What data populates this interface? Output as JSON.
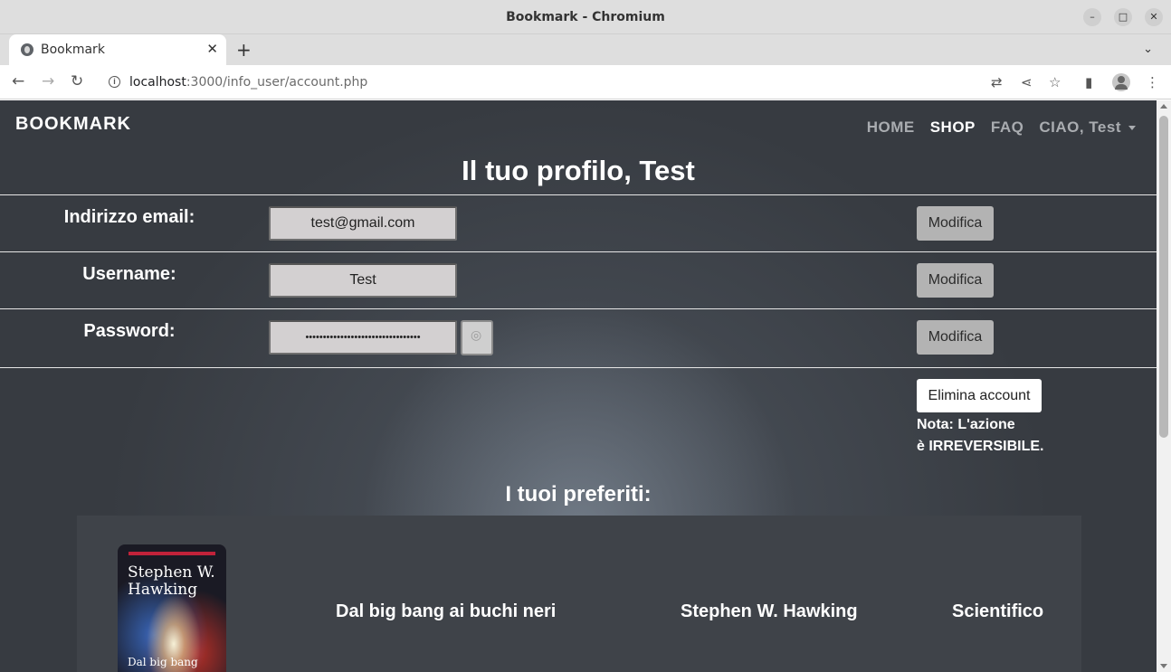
{
  "window": {
    "title": "Bookmark - Chromium"
  },
  "tabs": [
    {
      "label": "Bookmark"
    }
  ],
  "toolbar": {
    "url_host": "localhost",
    "url_rest": ":3000/info_user/account.php"
  },
  "site": {
    "brand": "BOOKMARK",
    "nav": [
      {
        "label": "HOME",
        "active": false
      },
      {
        "label": "SHOP",
        "active": true
      },
      {
        "label": "FAQ",
        "active": false
      },
      {
        "label": "CIAO, Test",
        "active": false
      }
    ]
  },
  "profile": {
    "title": "Il tuo profilo, Test",
    "rows": [
      {
        "label": "Indirizzo email:",
        "value": "test@gmail.com",
        "button": "Modifica"
      },
      {
        "label": "Username:",
        "value": "Test",
        "button": "Modifica"
      },
      {
        "label": "Password:",
        "value": "•••••••••••••••••••••••••••••••••",
        "button": "Modifica"
      }
    ],
    "delete_button": "Elimina account",
    "note_line1": "Nota: L'azione",
    "note_line2": "è IRREVERSIBILE."
  },
  "favorites": {
    "title": "I tuoi preferiti:",
    "items": [
      {
        "cover_author": "Stephen W. Hawking",
        "cover_title": "Dal big bang",
        "title": "Dal big bang ai buchi neri",
        "author": "Stephen W. Hawking",
        "genre": "Scientifico"
      }
    ]
  }
}
